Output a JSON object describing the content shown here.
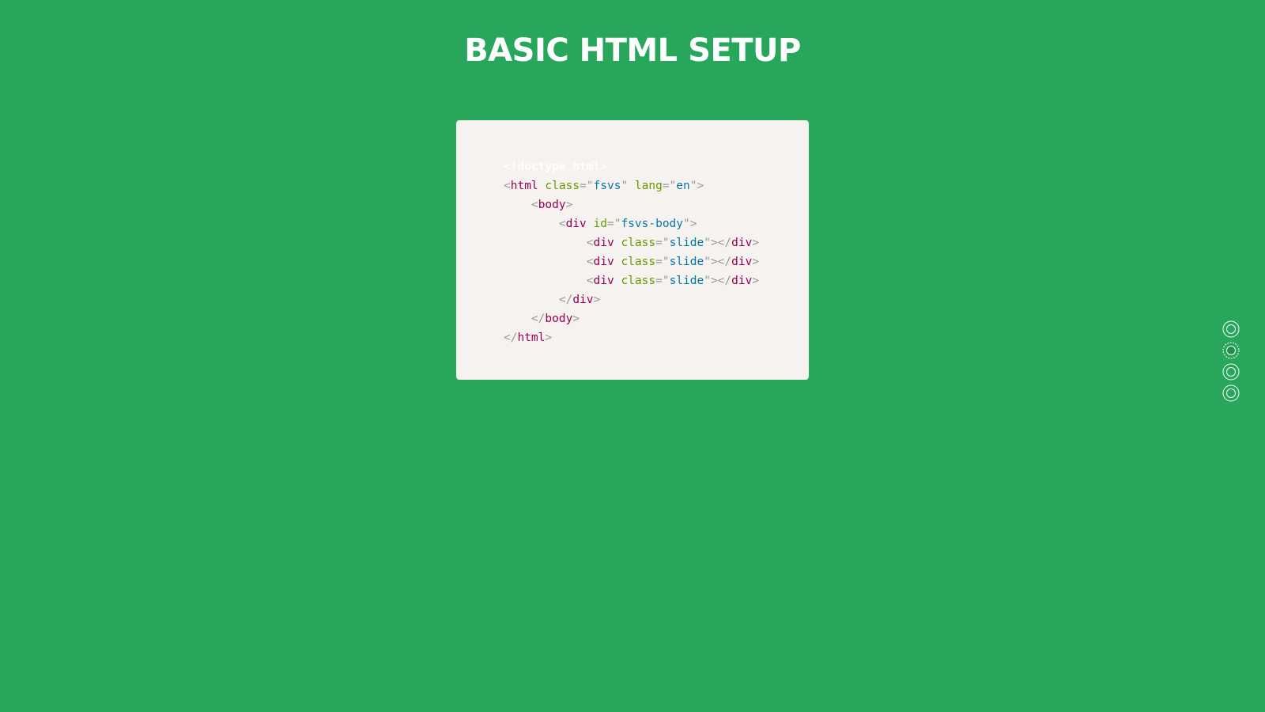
{
  "theme": {
    "background": "#27a65c",
    "card_background": "#f6f2ef",
    "tag_color": "#990055",
    "attr_color": "#669900",
    "value_color": "#0077aa",
    "punct_color": "#999999"
  },
  "slide": {
    "title": "BASIC HTML SETUP"
  },
  "code": {
    "lines": [
      {
        "indent": 0,
        "tokens": [
          {
            "t": "doctype",
            "v": "<!doctype html>"
          }
        ]
      },
      {
        "indent": 0,
        "tokens": [
          {
            "t": "punct",
            "v": "<"
          },
          {
            "t": "tag",
            "v": "html"
          },
          {
            "t": "plain",
            "v": " "
          },
          {
            "t": "attr",
            "v": "class"
          },
          {
            "t": "punct",
            "v": "=\""
          },
          {
            "t": "val",
            "v": "fsvs"
          },
          {
            "t": "punct",
            "v": "\""
          },
          {
            "t": "plain",
            "v": " "
          },
          {
            "t": "attr",
            "v": "lang"
          },
          {
            "t": "punct",
            "v": "=\""
          },
          {
            "t": "val",
            "v": "en"
          },
          {
            "t": "punct",
            "v": "\">"
          }
        ]
      },
      {
        "indent": 1,
        "tokens": [
          {
            "t": "punct",
            "v": "<"
          },
          {
            "t": "tag",
            "v": "body"
          },
          {
            "t": "punct",
            "v": ">"
          }
        ]
      },
      {
        "indent": 2,
        "tokens": [
          {
            "t": "punct",
            "v": "<"
          },
          {
            "t": "tag",
            "v": "div"
          },
          {
            "t": "plain",
            "v": " "
          },
          {
            "t": "attr",
            "v": "id"
          },
          {
            "t": "punct",
            "v": "=\""
          },
          {
            "t": "val",
            "v": "fsvs-body"
          },
          {
            "t": "punct",
            "v": "\">"
          }
        ]
      },
      {
        "indent": 3,
        "tokens": [
          {
            "t": "punct",
            "v": "<"
          },
          {
            "t": "tag",
            "v": "div"
          },
          {
            "t": "plain",
            "v": " "
          },
          {
            "t": "attr",
            "v": "class"
          },
          {
            "t": "punct",
            "v": "=\""
          },
          {
            "t": "val",
            "v": "slide"
          },
          {
            "t": "punct",
            "v": "\"></"
          },
          {
            "t": "tag",
            "v": "div"
          },
          {
            "t": "punct",
            "v": ">"
          }
        ]
      },
      {
        "indent": 3,
        "tokens": [
          {
            "t": "punct",
            "v": "<"
          },
          {
            "t": "tag",
            "v": "div"
          },
          {
            "t": "plain",
            "v": " "
          },
          {
            "t": "attr",
            "v": "class"
          },
          {
            "t": "punct",
            "v": "=\""
          },
          {
            "t": "val",
            "v": "slide"
          },
          {
            "t": "punct",
            "v": "\"></"
          },
          {
            "t": "tag",
            "v": "div"
          },
          {
            "t": "punct",
            "v": ">"
          }
        ]
      },
      {
        "indent": 3,
        "tokens": [
          {
            "t": "punct",
            "v": "<"
          },
          {
            "t": "tag",
            "v": "div"
          },
          {
            "t": "plain",
            "v": " "
          },
          {
            "t": "attr",
            "v": "class"
          },
          {
            "t": "punct",
            "v": "=\""
          },
          {
            "t": "val",
            "v": "slide"
          },
          {
            "t": "punct",
            "v": "\"></"
          },
          {
            "t": "tag",
            "v": "div"
          },
          {
            "t": "punct",
            "v": ">"
          }
        ]
      },
      {
        "indent": 2,
        "tokens": [
          {
            "t": "punct",
            "v": "</"
          },
          {
            "t": "tag",
            "v": "div"
          },
          {
            "t": "punct",
            "v": ">"
          }
        ]
      },
      {
        "indent": 1,
        "tokens": [
          {
            "t": "punct",
            "v": "</"
          },
          {
            "t": "tag",
            "v": "body"
          },
          {
            "t": "punct",
            "v": ">"
          }
        ]
      },
      {
        "indent": 0,
        "tokens": [
          {
            "t": "punct",
            "v": "</"
          },
          {
            "t": "tag",
            "v": "html"
          },
          {
            "t": "punct",
            "v": ">"
          }
        ]
      }
    ]
  },
  "pagination": {
    "icon": "circle-dot-icon",
    "dots": [
      {
        "active": false
      },
      {
        "active": true
      },
      {
        "active": false
      },
      {
        "active": false
      }
    ]
  }
}
